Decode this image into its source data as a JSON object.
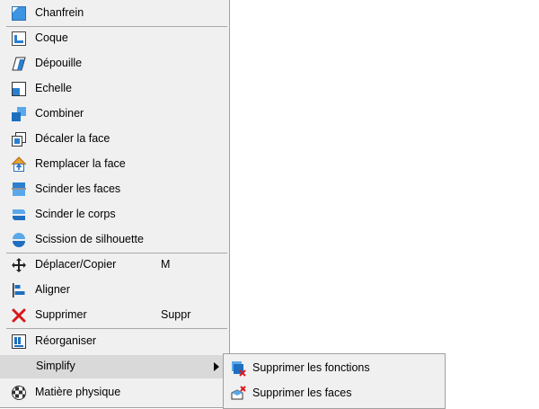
{
  "menu": {
    "items": [
      {
        "label": "Chanfrein",
        "icon": "chamfer-icon"
      },
      {
        "label": "Coque",
        "icon": "shell-icon"
      },
      {
        "label": "Dépouille",
        "icon": "draft-icon"
      },
      {
        "label": "Echelle",
        "icon": "scale-icon"
      },
      {
        "label": "Combiner",
        "icon": "combine-icon"
      },
      {
        "label": "Décaler la face",
        "icon": "offset-face-icon"
      },
      {
        "label": "Remplacer la face",
        "icon": "replace-face-icon"
      },
      {
        "label": "Scinder les faces",
        "icon": "split-faces-icon"
      },
      {
        "label": "Scinder le corps",
        "icon": "split-body-icon"
      },
      {
        "label": "Scission de silhouette",
        "icon": "silhouette-split-icon"
      },
      {
        "label": "Déplacer/Copier",
        "shortcut": "M",
        "icon": "move-copy-icon"
      },
      {
        "label": "Aligner",
        "icon": "align-icon"
      },
      {
        "label": "Supprimer",
        "shortcut": "Suppr",
        "icon": "delete-icon"
      },
      {
        "label": "Réorganiser",
        "icon": "rearrange-icon"
      },
      {
        "label": "Simplify",
        "icon": "",
        "highlighted": true,
        "has_submenu": true
      },
      {
        "label": "Matière physique",
        "icon": "physical-material-icon"
      }
    ]
  },
  "submenu": {
    "items": [
      {
        "label": "Supprimer les fonctions",
        "icon": "remove-features-icon"
      },
      {
        "label": "Supprimer les faces",
        "icon": "remove-faces-icon"
      }
    ]
  },
  "colors": {
    "menu_bg": "#f0f0f0",
    "highlight_bg": "#d9d9d9",
    "icon_blue": "#1e7fd0",
    "delete_red": "#d7191c"
  }
}
